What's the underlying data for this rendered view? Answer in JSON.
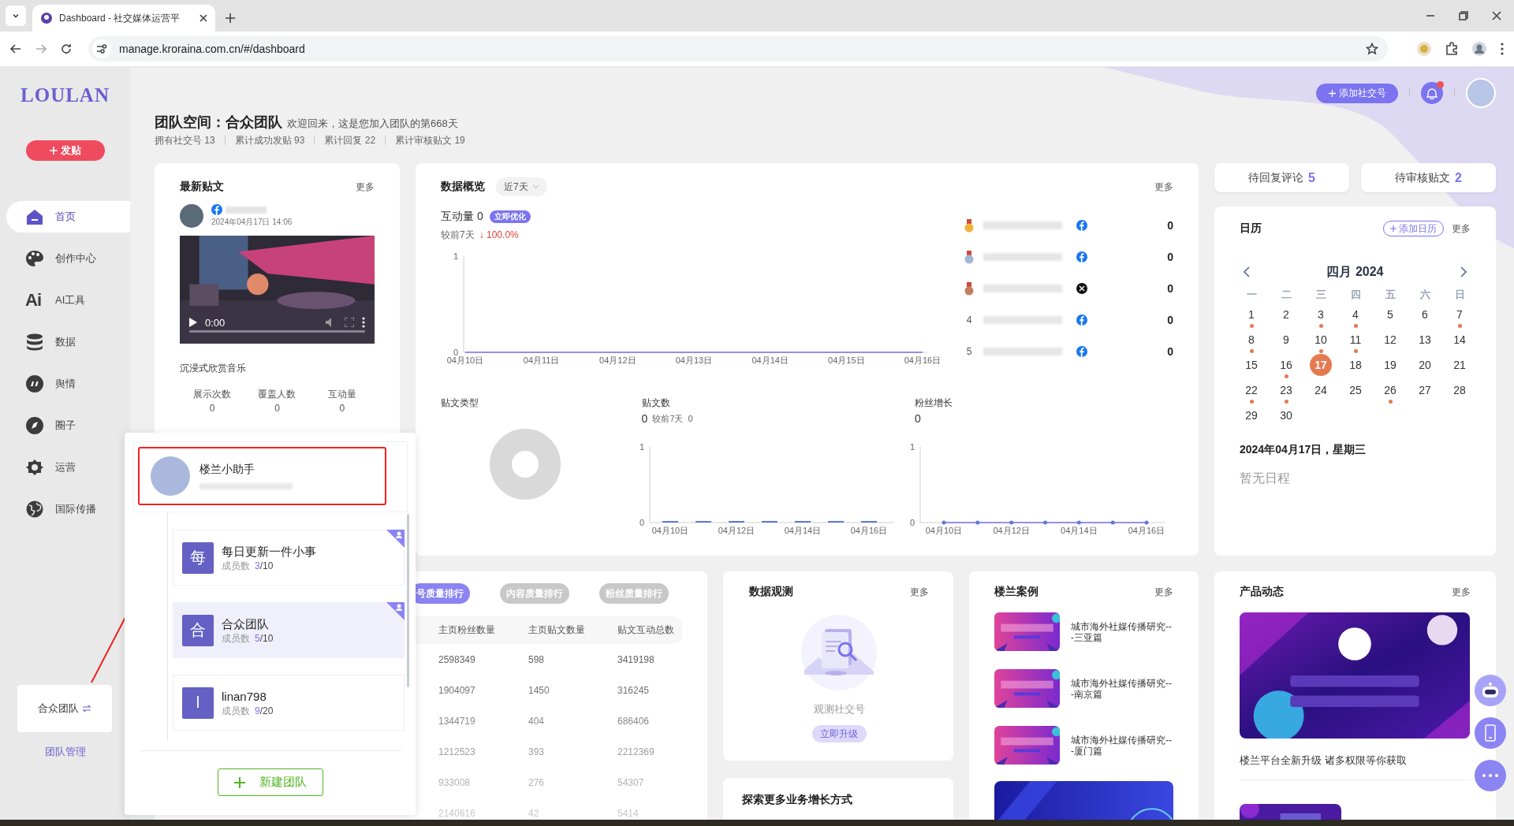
{
  "browser": {
    "tab_title": "Dashboard - 社交媒体运营平",
    "url": "manage.kroraina.com.cn/#/dashboard"
  },
  "sidebar": {
    "logo": "LOULAN",
    "post_button": "发贴",
    "items": [
      {
        "label": "首页",
        "selected": true
      },
      {
        "label": "创作中心",
        "selected": false
      },
      {
        "label": "AI工具",
        "icon_text": "Ai",
        "selected": false
      },
      {
        "label": "数据",
        "selected": false
      },
      {
        "label": "舆情",
        "selected": false
      },
      {
        "label": "圈子",
        "selected": false
      },
      {
        "label": "运营",
        "selected": false
      },
      {
        "label": "国际传播",
        "selected": false
      }
    ],
    "team_switcher": "合众团队",
    "team_manage": "团队管理"
  },
  "header": {
    "add_account": "添加社交号",
    "has_notification": true,
    "team_label": "团队空间：合众团队",
    "welcome": "欢迎回来，这是您加入团队的第668天",
    "stats": [
      "拥有社交号 13",
      "累计成功发贴 93",
      "累计回复 22",
      "累计审核贴文 19"
    ]
  },
  "pending": [
    {
      "label": "待回复评论",
      "count": "5"
    },
    {
      "label": "待审核贴文",
      "count": "2"
    }
  ],
  "latest_post": {
    "title": "最新贴文",
    "more": "更多",
    "date": "2024年04月17日 14:06",
    "video_time": "0:00",
    "caption": "沉浸式欣赏音乐",
    "stats": [
      {
        "label": "展示次数",
        "value": "0"
      },
      {
        "label": "覆盖人数",
        "value": "0"
      },
      {
        "label": "互动量",
        "value": "0"
      }
    ]
  },
  "overview": {
    "title": "数据概览",
    "range": "近7天",
    "more": "更多",
    "metric": "互动量 0",
    "optimize": "立即优化",
    "compare_label": "较前7天",
    "compare_value": "↓ 100.0%",
    "chart_data": {
      "type": "line",
      "categories": [
        "04月10日",
        "04月11日",
        "04月12日",
        "04月13日",
        "04月14日",
        "04月15日",
        "04月16日"
      ],
      "values": [
        0,
        0,
        0,
        0,
        0,
        0,
        0
      ],
      "ylim": [
        0,
        1
      ],
      "yticks": [
        0,
        1
      ]
    },
    "ranking": [
      {
        "kind": "medal",
        "color": "#f0b43c",
        "platform": {
          "kind": "facebook"
        },
        "value": "0"
      },
      {
        "kind": "medal",
        "color": "#9fb8d6",
        "platform": {
          "kind": "facebook"
        },
        "value": "0"
      },
      {
        "kind": "medal",
        "color": "#c08060",
        "platform": {
          "kind": "x"
        },
        "value": "0"
      },
      {
        "kind": "number",
        "rank": "4",
        "platform": {
          "kind": "facebook"
        },
        "value": "0"
      },
      {
        "kind": "number",
        "rank": "5",
        "platform": {
          "kind": "facebook"
        },
        "value": "0"
      }
    ],
    "post_types_title": "贴文类型",
    "post_count": {
      "value": "0",
      "compare_label": "较前7天",
      "compare_value": "0",
      "chart_data": {
        "type": "bar",
        "title": "贴文数",
        "categories": [
          "04月10日",
          null,
          "04月12日",
          null,
          "04月14日",
          null,
          "04月16日"
        ],
        "values": [
          0,
          0,
          0,
          0,
          0,
          0,
          0
        ],
        "ylim": [
          0,
          1
        ],
        "yticks": [
          0,
          1
        ]
      }
    },
    "fans": {
      "value": "0",
      "chart_data": {
        "type": "line",
        "title": "粉丝增长",
        "categories": [
          "04月10日",
          null,
          "04月12日",
          null,
          "04月14日",
          null,
          "04月16日"
        ],
        "values": [
          0,
          0,
          0,
          0,
          0,
          0,
          0
        ],
        "ylim": [
          0,
          1
        ],
        "yticks": [
          0,
          1
        ]
      }
    }
  },
  "calendar": {
    "title": "日历",
    "add": "添加日历",
    "more": "更多",
    "month": "四月 2024",
    "weekdays": [
      "一",
      "二",
      "三",
      "四",
      "五",
      "六",
      "日"
    ],
    "days": [
      {
        "day": "1",
        "event": true,
        "selected": false
      },
      {
        "day": "2",
        "event": false,
        "selected": false
      },
      {
        "day": "3",
        "event": true,
        "selected": false
      },
      {
        "day": "4",
        "event": true,
        "selected": false
      },
      {
        "day": "5",
        "event": false,
        "selected": false
      },
      {
        "day": "6",
        "event": false,
        "selected": false
      },
      {
        "day": "7",
        "event": true,
        "selected": false
      },
      {
        "day": "8",
        "event": true,
        "selected": false
      },
      {
        "day": "9",
        "event": false,
        "selected": false
      },
      {
        "day": "10",
        "event": true,
        "selected": false
      },
      {
        "day": "11",
        "event": true,
        "selected": false
      },
      {
        "day": "12",
        "event": false,
        "selected": false
      },
      {
        "day": "13",
        "event": false,
        "selected": false
      },
      {
        "day": "14",
        "event": false,
        "selected": false
      },
      {
        "day": "15",
        "event": false,
        "selected": false
      },
      {
        "day": "16",
        "event": true,
        "selected": false
      },
      {
        "day": "17",
        "event": false,
        "selected": true
      },
      {
        "day": "18",
        "event": false,
        "selected": false
      },
      {
        "day": "19",
        "event": false,
        "selected": false
      },
      {
        "day": "20",
        "event": false,
        "selected": false
      },
      {
        "day": "21",
        "event": false,
        "selected": false
      },
      {
        "day": "22",
        "event": true,
        "selected": false
      },
      {
        "day": "23",
        "event": true,
        "selected": false
      },
      {
        "day": "24",
        "event": false,
        "selected": false
      },
      {
        "day": "25",
        "event": false,
        "selected": false
      },
      {
        "day": "26",
        "event": true,
        "selected": false
      },
      {
        "day": "27",
        "event": false,
        "selected": false
      },
      {
        "day": "28",
        "event": false,
        "selected": false
      },
      {
        "day": "29",
        "event": false,
        "selected": false
      },
      {
        "day": "30",
        "event": false,
        "selected": false
      }
    ],
    "selected_date": "2024年04月17日，星期三",
    "empty": "暂无日程"
  },
  "rankings": {
    "tabs": [
      {
        "label": "号质量排行",
        "selected": true
      },
      {
        "label": "内容质量排行",
        "selected": false
      },
      {
        "label": "粉丝质量排行",
        "selected": false
      }
    ],
    "columns": [
      "主页粉丝数量",
      "主页贴文数量",
      "贴文互动总数"
    ],
    "rows": [
      [
        "2598349",
        "598",
        "3419198"
      ],
      [
        "1904097",
        "1450",
        "316245"
      ],
      [
        "1344719",
        "404",
        "686406"
      ],
      [
        "1212523",
        "393",
        "2212369"
      ],
      [
        "933008",
        "276",
        "54307"
      ],
      [
        "2140616",
        "42",
        "5414"
      ]
    ]
  },
  "observe": {
    "title": "数据观测",
    "more": "更多",
    "label": "观测社交号",
    "button": "立即升级"
  },
  "explore": {
    "title": "探索更多业务增长方式"
  },
  "cases": {
    "title": "楼兰案例",
    "more": "更多",
    "items": [
      {
        "title": "城市海外社媒传播研究---三亚篇"
      },
      {
        "title": "城市海外社媒传播研究---南京篇"
      },
      {
        "title": "城市海外社媒传播研究---厦门篇"
      }
    ]
  },
  "news": {
    "title": "产品动态",
    "more": "更多",
    "caption": "楼兰平台全新升级 诸多权限等你获取"
  },
  "team_popup": {
    "personal": {
      "name": "楼兰小助手",
      "highlighted": true
    },
    "teams": [
      {
        "initial": "每",
        "name": "每日更新一件小事",
        "members_label": "成员数",
        "members": "3",
        "limit": "/10",
        "owner": true,
        "selected": false
      },
      {
        "initial": "合",
        "name": "合众团队",
        "members_label": "成员数",
        "members": "5",
        "limit": "/10",
        "owner": true,
        "selected": true
      },
      {
        "initial": "l",
        "name": "linan798",
        "members_label": "成员数",
        "members": "9",
        "limit": "/20",
        "owner": false,
        "selected": false
      }
    ],
    "create": "新建团队"
  }
}
